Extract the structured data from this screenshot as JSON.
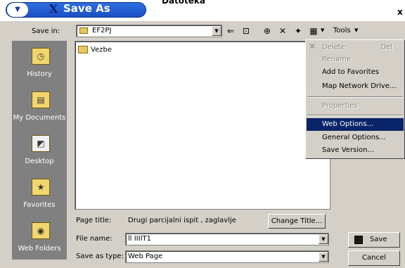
{
  "window": {
    "title": "Save As",
    "title_icon": "X",
    "close_glyph": "x",
    "background_text": "Datoteka"
  },
  "toolbar": {
    "save_in_label": "Save in:",
    "save_in_value": "EF2PJ",
    "tools_label": "Tools",
    "icons": [
      "back-icon",
      "up-folder-icon",
      "search-web-icon",
      "delete-icon",
      "new-folder-icon",
      "views-icon"
    ]
  },
  "places": [
    {
      "label": "History",
      "icon": "history-icon"
    },
    {
      "label": "My Documents",
      "icon": "my-documents-icon"
    },
    {
      "label": "Desktop",
      "icon": "desktop-icon"
    },
    {
      "label": "Favorites",
      "icon": "favorites-icon"
    },
    {
      "label": "Web Folders",
      "icon": "web-folders-icon"
    }
  ],
  "files": [
    {
      "name": "Vezbe",
      "type": "folder"
    }
  ],
  "tools_menu": {
    "items": [
      {
        "label": "Delete",
        "shortcut": "Del",
        "enabled": false
      },
      {
        "label": "Rename",
        "shortcut": "",
        "enabled": false
      },
      {
        "label": "Add to Favorites",
        "shortcut": "",
        "enabled": true
      },
      {
        "label": "Map Network Drive...",
        "shortcut": "",
        "enabled": true
      },
      {
        "label": "Properties",
        "shortcut": "",
        "enabled": false
      },
      {
        "label": "Web Options...",
        "shortcut": "",
        "enabled": true,
        "selected": true
      },
      {
        "label": "General Options...",
        "shortcut": "",
        "enabled": true
      },
      {
        "label": "Save Version...",
        "shortcut": "",
        "enabled": true
      }
    ]
  },
  "form": {
    "page_title_label": "Page title:",
    "page_title_value": "Drugi parcijalni ispit , zaglavlje",
    "change_title_label": "Change Title...",
    "file_name_label": "File name:",
    "file_name_value": "ll IIIIT1",
    "save_type_label": "Save as type:",
    "save_type_value": "Web Page"
  },
  "buttons": {
    "save": "Save",
    "cancel": "Cancel"
  },
  "colors": {
    "title_blue": "#1a4fc4",
    "dialog_face": "#d4d0c8",
    "places_bg": "#808080",
    "menu_highlight": "#0a246a"
  }
}
